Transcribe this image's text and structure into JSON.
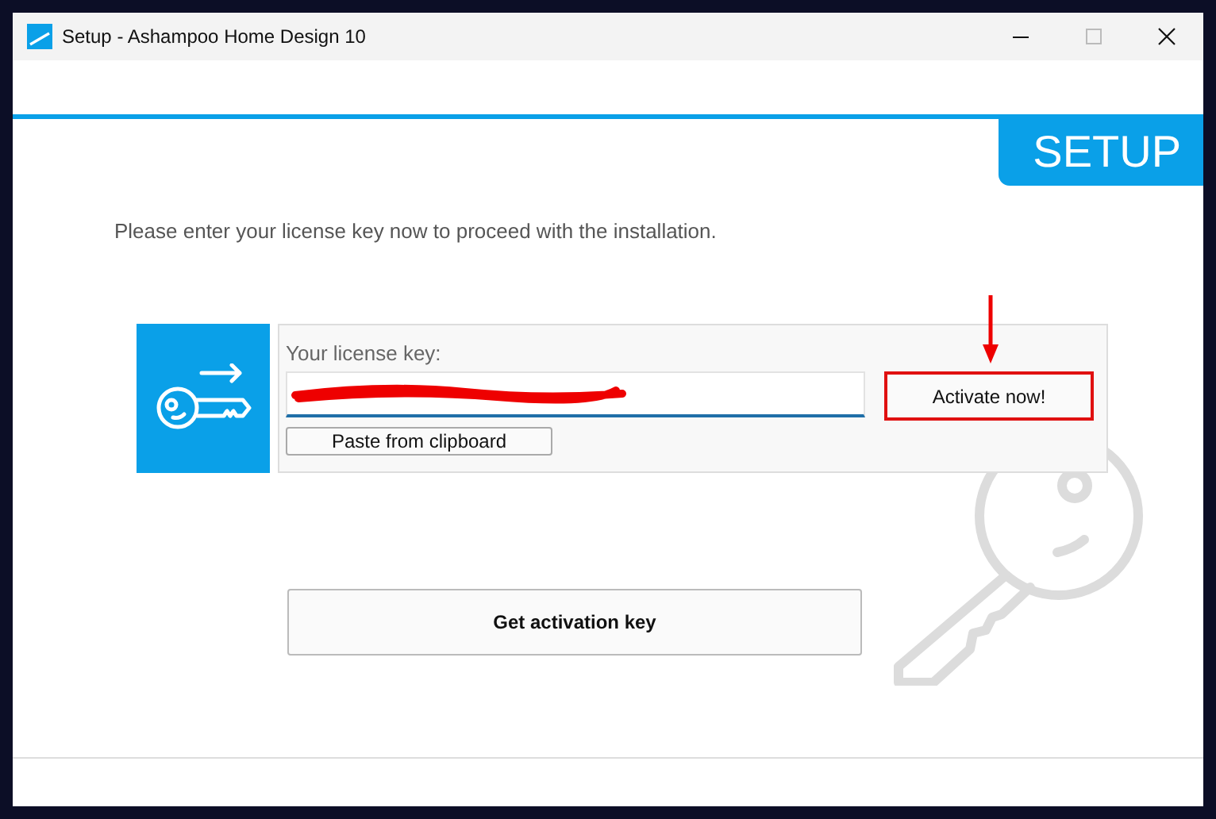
{
  "window": {
    "title": "Setup - Ashampoo Home Design 10"
  },
  "banner": {
    "label": "SETUP"
  },
  "instruction": "Please enter your license key now to proceed with the installation.",
  "license": {
    "label": "Your license key:",
    "paste_button": "Paste from clipboard",
    "activate_button": "Activate now!"
  },
  "get_key_button": "Get activation key"
}
